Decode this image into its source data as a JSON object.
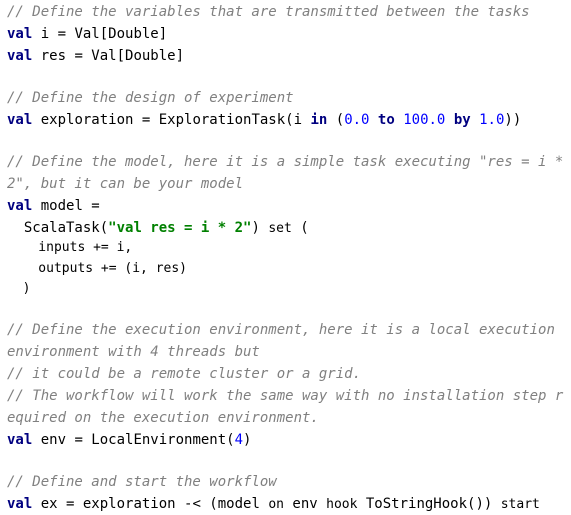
{
  "comments": {
    "c1": "// Define the variables that are transmitted between the tasks",
    "c2": "// Define the design of experiment",
    "c3a": "// Define the model, here it is a simple task executing \"res = i *",
    "c3b": "2\", but it can be your model",
    "c4a": "// Define the execution environment, here it is a local execution",
    "c4b": "environment with 4 threads but",
    "c4c": "// it could be a remote cluster or a grid.",
    "c4d": "// The workflow will work the same way with no installation step r",
    "c4e": "equired on the execution environment.",
    "c5": "// Define and start the workflow"
  },
  "tokens": {
    "val": "val",
    "in": "in",
    "to": "to",
    "by": "by",
    "set": "set",
    "on": "on",
    "hook": "hook",
    "start": "start",
    "i_decl": " i = Val[Double]",
    "res_decl": " res = Val[Double]",
    "exploration_decl": " exploration = ExplorationTask(i ",
    "num_0": "0.0",
    "num_100": "100.0",
    "num_1": "1.0",
    "open_paren": "(",
    "close_parens": "))",
    "model_decl": " model =",
    "scalatask": "  ScalaTask(",
    "scala_string": "\"val res = i * 2\"",
    "close_paren_space": ") ",
    "open_paren_end": " (",
    "inputs_line": "    inputs += i,",
    "outputs_line": "    outputs += (i, res)",
    "close_line": "  )",
    "env_decl": " env = LocalEnvironment(",
    "num_4": "4",
    "close_paren": ")",
    "ex_decl": " ex = exploration -< (model ",
    "env_word": " env ",
    "tostringhook": " ToStringHook()) "
  }
}
